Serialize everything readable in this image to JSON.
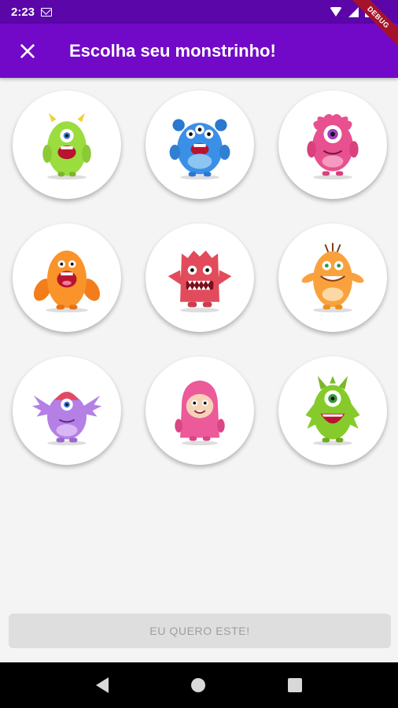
{
  "status": {
    "time": "2:23",
    "icons": [
      "mail-icon",
      "wifi-icon",
      "signal-icon",
      "battery-icon"
    ]
  },
  "appbar": {
    "title": "Escolha seu monstrinho!",
    "close_icon": "close-icon",
    "color": "#7209c8"
  },
  "debug_banner": "DEBUG",
  "monsters": [
    {
      "id": "monster-1",
      "color": "#9bdc3e"
    },
    {
      "id": "monster-2",
      "color": "#3a8fe6"
    },
    {
      "id": "monster-3",
      "color": "#e8508f"
    },
    {
      "id": "monster-4",
      "color": "#f9932a"
    },
    {
      "id": "monster-5",
      "color": "#e24b5b"
    },
    {
      "id": "monster-6",
      "color": "#f9a23d"
    },
    {
      "id": "monster-7",
      "color": "#b480e6"
    },
    {
      "id": "monster-8",
      "color": "#ec5a9a"
    },
    {
      "id": "monster-9",
      "color": "#86cb2b"
    }
  ],
  "confirm_button": {
    "label": "EU QUERO ESTE!"
  },
  "navbar": {
    "icons": [
      "back-icon",
      "home-icon",
      "recents-icon"
    ]
  }
}
